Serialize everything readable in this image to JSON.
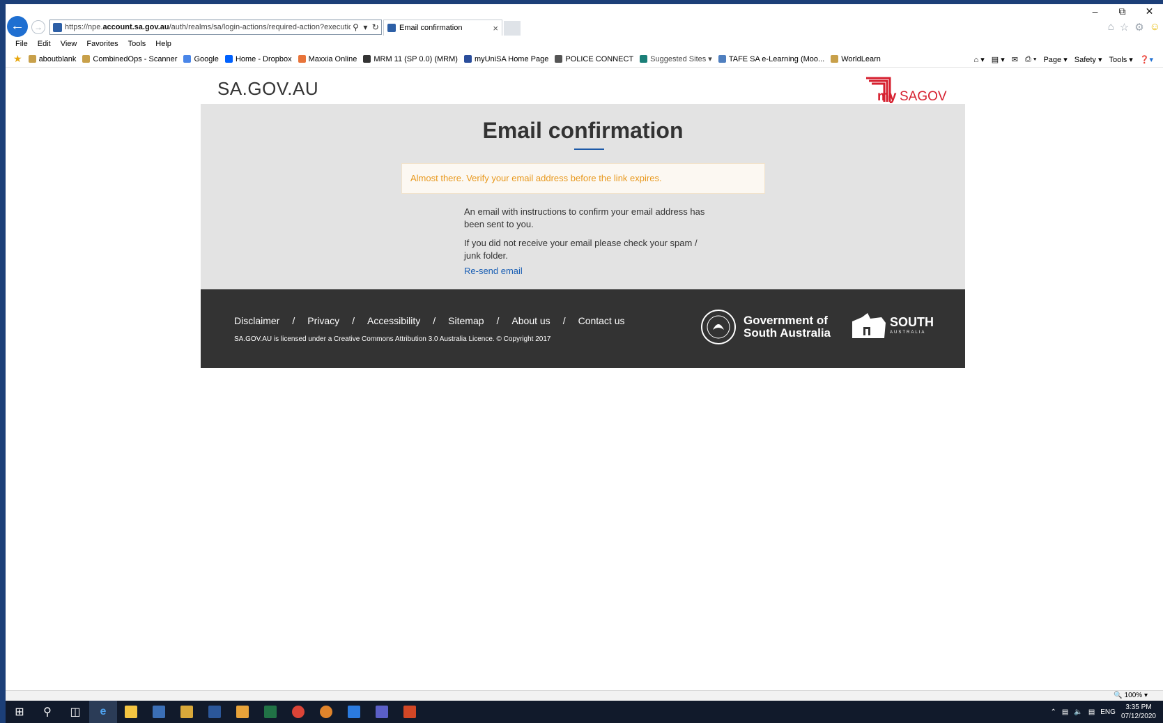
{
  "browser": {
    "url_prefix": "https://npe.",
    "url_domain": "account.sa.gov.au",
    "url_rest": "/auth/realms/sa/login-actions/required-action?execution",
    "tab_title": "Email confirmation",
    "menu": [
      "File",
      "Edit",
      "View",
      "Favorites",
      "Tools",
      "Help"
    ],
    "favorites": [
      "aboutblank",
      "CombinedOps - Scanner",
      "Google",
      "Home - Dropbox",
      "Maxxia Online",
      "MRM 11 (SP 0.0) (MRM)",
      "myUniSA Home Page",
      "POLICE CONNECT",
      "Suggested Sites ▾",
      "TAFE SA e-Learning (Moo...",
      "WorldLearn"
    ],
    "commands": [
      "Page ▾",
      "Safety ▾",
      "Tools ▾"
    ],
    "zoom": "100%"
  },
  "site": {
    "brand": "SA.GOV.AU",
    "logo_text_my": "my",
    "logo_text_sagov": "SAGOV"
  },
  "main": {
    "title": "Email confirmation",
    "alert": "Almost there. Verify your email address before the link expires.",
    "message1": "An email with instructions to confirm your email address has been sent to you.",
    "message2": "If you did not receive your email please check your spam / junk folder.",
    "resend": "Re-send email"
  },
  "footer": {
    "links": [
      "Disclaimer",
      "Privacy",
      "Accessibility",
      "Sitemap",
      "About us",
      "Contact us"
    ],
    "separator": "/",
    "license": "SA.GOV.AU is licensed under a Creative Commons Attribution 3.0 Australia Licence. © Copyright 2017",
    "gov_line1": "Government of",
    "gov_line2": "South Australia",
    "south": "SOUTH",
    "australia": "AUSTRALIA"
  },
  "taskbar": {
    "lang": "ENG",
    "time": "3:35 PM",
    "date": "07/12/2020"
  },
  "colors": {
    "accent_blue": "#1d5aa8",
    "alert_text": "#e8981c",
    "footer_bg": "#333333",
    "logo_red": "#d6202f"
  }
}
